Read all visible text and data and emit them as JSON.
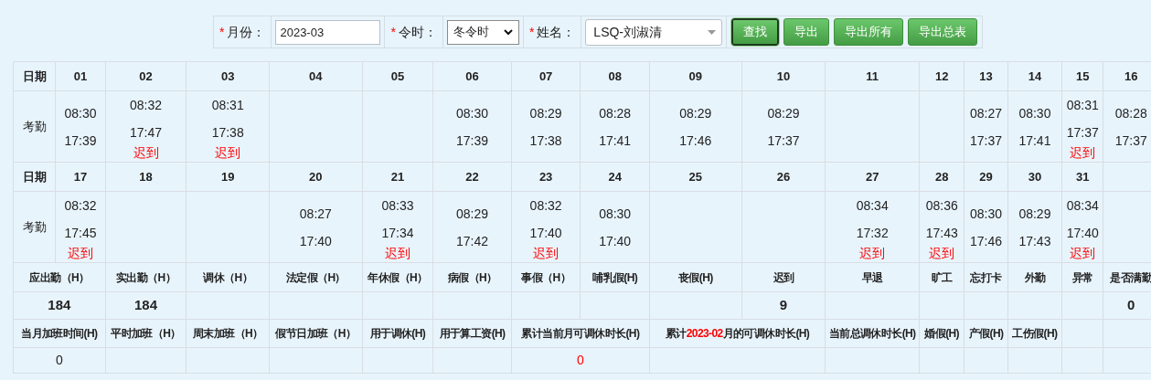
{
  "toolbar": {
    "fields": [
      {
        "kind": "input",
        "required_mark": "*",
        "label": "月份：",
        "value": "2023-03"
      },
      {
        "kind": "select",
        "required_mark": "*",
        "label": "令时：",
        "value": "冬令时"
      },
      {
        "kind": "combo",
        "required_mark": "*",
        "label": "姓名：",
        "value": "LSQ-刘淑清"
      }
    ],
    "buttons": [
      {
        "label": "查找",
        "focused": true
      },
      {
        "label": "导出",
        "focused": false
      },
      {
        "label": "导出所有",
        "focused": false
      },
      {
        "label": "导出总表",
        "focused": false
      }
    ]
  },
  "attendance": [
    {
      "date_label": "日期",
      "row_label": "考勤",
      "days": [
        {
          "date": "01",
          "in": "08:30",
          "out": "17:39"
        },
        {
          "date": "02",
          "in": "08:32",
          "out": "17:47",
          "status": "迟到"
        },
        {
          "date": "03",
          "in": "08:31",
          "out": "17:38",
          "status": "迟到"
        },
        {
          "date": "04"
        },
        {
          "date": "05"
        },
        {
          "date": "06",
          "in": "08:30",
          "out": "17:39"
        },
        {
          "date": "07",
          "in": "08:29",
          "out": "17:38"
        },
        {
          "date": "08",
          "in": "08:28",
          "out": "17:41"
        },
        {
          "date": "09",
          "in": "08:29",
          "out": "17:46"
        },
        {
          "date": "10",
          "in": "08:29",
          "out": "17:37"
        },
        {
          "date": "11"
        },
        {
          "date": "12"
        },
        {
          "date": "13",
          "in": "08:27",
          "out": "17:37"
        },
        {
          "date": "14",
          "in": "08:30",
          "out": "17:41"
        },
        {
          "date": "15",
          "in": "08:31",
          "out": "17:37",
          "status": "迟到"
        },
        {
          "date": "16",
          "in": "08:28",
          "out": "17:37"
        }
      ]
    },
    {
      "date_label": "日期",
      "row_label": "考勤",
      "days": [
        {
          "date": "17",
          "in": "08:32",
          "out": "17:45",
          "status": "迟到"
        },
        {
          "date": "18"
        },
        {
          "date": "19"
        },
        {
          "date": "20",
          "in": "08:27",
          "out": "17:40"
        },
        {
          "date": "21",
          "in": "08:33",
          "out": "17:34",
          "status": "迟到"
        },
        {
          "date": "22",
          "in": "08:29",
          "out": "17:42"
        },
        {
          "date": "23",
          "in": "08:32",
          "out": "17:40",
          "status": "迟到"
        },
        {
          "date": "24",
          "in": "08:30",
          "out": "17:40"
        },
        {
          "date": "25"
        },
        {
          "date": "26"
        },
        {
          "date": "27",
          "in": "08:34",
          "out": "17:32",
          "status": "迟到"
        },
        {
          "date": "28",
          "in": "08:36",
          "out": "17:43",
          "status": "迟到"
        },
        {
          "date": "29",
          "in": "08:30",
          "out": "17:46"
        },
        {
          "date": "30",
          "in": "08:29",
          "out": "17:43"
        },
        {
          "date": "31",
          "in": "08:34",
          "out": "17:40",
          "status": "迟到"
        }
      ]
    }
  ],
  "summary": [
    {
      "cells": [
        {
          "kind": "double",
          "label": "应出勤（H）",
          "value": "184"
        },
        {
          "kind": "single",
          "label": "实出勤（H）",
          "value": "184"
        },
        {
          "kind": "single",
          "label": "调休（H）"
        },
        {
          "kind": "single",
          "label": "法定假（H）"
        },
        {
          "kind": "single",
          "label": "年休假（H）"
        },
        {
          "kind": "single",
          "label": "病假（H）"
        },
        {
          "kind": "single",
          "label": "事假（H）"
        },
        {
          "kind": "single",
          "label": "哺乳假(H)"
        },
        {
          "kind": "single",
          "label": "丧假(H)"
        },
        {
          "kind": "single",
          "label": "迟到",
          "value": "9"
        },
        {
          "kind": "single",
          "label": "早退"
        },
        {
          "kind": "single",
          "label": "旷工"
        },
        {
          "kind": "single",
          "label": "忘打卡"
        },
        {
          "kind": "single",
          "label": "外勤"
        },
        {
          "kind": "single",
          "label": "异常"
        },
        {
          "kind": "single",
          "label": "是否满勤",
          "value": "0"
        }
      ]
    },
    {
      "cells": [
        {
          "kind": "double",
          "label": [
            {
              "text": "当月加班时间(H)",
              "highlight": false
            }
          ],
          "value": "0",
          "highlight": false
        },
        {
          "kind": "single",
          "label": [
            {
              "text": "平时加班（H）",
              "highlight": false
            }
          ]
        },
        {
          "kind": "single",
          "label": [
            {
              "text": "周末加班（H）",
              "highlight": false
            }
          ]
        },
        {
          "kind": "single",
          "label": [
            {
              "text": "假节日加班（H）",
              "highlight": false
            }
          ]
        },
        {
          "kind": "single",
          "label": [
            {
              "text": "用于调休(H)",
              "highlight": false
            }
          ]
        },
        {
          "kind": "single",
          "label": [
            {
              "text": "用于算工资(H)",
              "highlight": false
            }
          ]
        },
        {
          "kind": "double",
          "label": [
            {
              "text": "累计当前月可调休时长(H)",
              "highlight": false
            }
          ],
          "value": "0",
          "highlight": true
        },
        {
          "kind": "double",
          "label": [
            {
              "text": "累计",
              "highlight": false
            },
            {
              "text": "2023-02",
              "highlight": true
            },
            {
              "text": "月的可调休时长(H)",
              "highlight": false
            }
          ]
        },
        {
          "kind": "single",
          "label": [
            {
              "text": "当前总调休时长(H)",
              "highlight": false
            }
          ]
        },
        {
          "kind": "single",
          "label": [
            {
              "text": "婚假(H)",
              "highlight": false
            }
          ]
        },
        {
          "kind": "single",
          "label": [
            {
              "text": "产假(H)",
              "highlight": false
            }
          ]
        },
        {
          "kind": "single",
          "label": [
            {
              "text": "工伤假(H)",
              "highlight": false
            }
          ]
        },
        {
          "kind": "single"
        },
        {
          "kind": "single"
        }
      ]
    }
  ]
}
